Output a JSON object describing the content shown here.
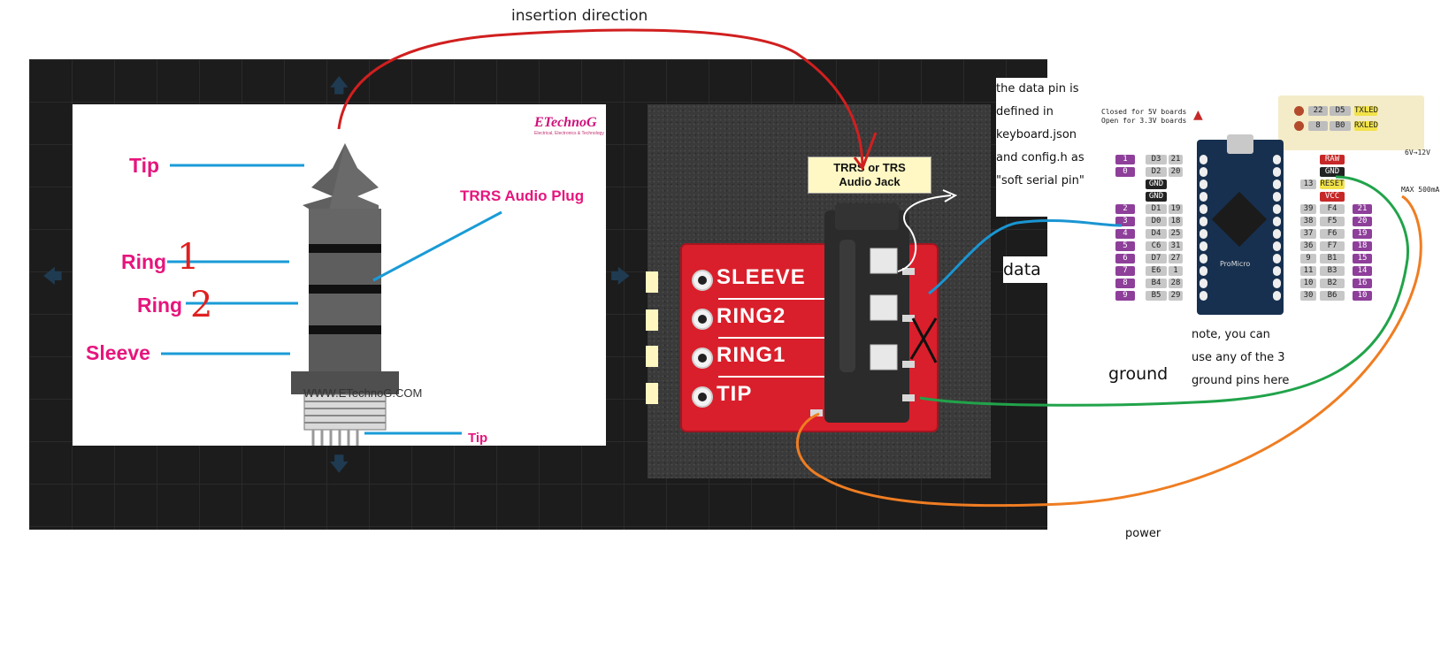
{
  "header": {
    "title": "insertion direction"
  },
  "plug": {
    "brand": "ETechnoG",
    "brand_sub": "Electrical, Electronics & Technology",
    "labels": {
      "tip": "Tip",
      "ring1": "Ring",
      "ring1_num": "1",
      "ring2": "Ring",
      "ring2_num": "2",
      "sleeve": "Sleeve",
      "plug_name": "TRRS Audio Plug",
      "tip_bottom": "Tip"
    },
    "website": "WWW.ETechnoG.COM"
  },
  "jack": {
    "tag_line1": "TRRS or TRS",
    "tag_line2": "Audio Jack",
    "pins": [
      "SLEEVE",
      "RING2",
      "RING1",
      "TIP"
    ]
  },
  "note": {
    "lines": [
      "the data pin is",
      "defined in",
      "keyboard.json",
      "and config.h as",
      "\"soft serial pin\""
    ]
  },
  "wires": {
    "data": "data",
    "ground": "ground",
    "power": "power"
  },
  "ground_note": {
    "lines": [
      "note, you can",
      "use any of the 3",
      "ground pins here"
    ]
  },
  "board": {
    "name": "ProMicro",
    "jumper_note_1": "Closed for 5V boards",
    "jumper_note_2": "Open for 3.3V boards",
    "leds": [
      {
        "num": "22",
        "pin": "D5",
        "tag": "TXLED"
      },
      {
        "num": "8",
        "pin": "B0",
        "tag": "RXLED"
      }
    ],
    "left_pins": [
      {
        "a": "1",
        "b": "D3",
        "c": "21"
      },
      {
        "a": "0",
        "b": "D2",
        "c": "20"
      },
      {
        "a": "",
        "b": "GND",
        "c": ""
      },
      {
        "a": "",
        "b": "GND",
        "c": ""
      },
      {
        "a": "2",
        "b": "D1",
        "c": "19"
      },
      {
        "a": "3",
        "b": "D0",
        "c": "18"
      },
      {
        "a": "4",
        "b": "D4",
        "c": "25"
      },
      {
        "a": "5",
        "b": "C6",
        "c": "31"
      },
      {
        "a": "6",
        "b": "D7",
        "c": "27"
      },
      {
        "a": "7",
        "b": "E6",
        "c": "1"
      },
      {
        "a": "8",
        "b": "B4",
        "c": "28"
      },
      {
        "a": "9",
        "b": "B5",
        "c": "29"
      }
    ],
    "right_pins": [
      {
        "a": "RAW",
        "b": "",
        "c": ""
      },
      {
        "a": "GND",
        "b": "",
        "c": ""
      },
      {
        "a": "RESET",
        "b": "13",
        "c": ""
      },
      {
        "a": "VCC",
        "b": "",
        "c": ""
      },
      {
        "a": "F4",
        "b": "39",
        "c": "21"
      },
      {
        "a": "F5",
        "b": "38",
        "c": "20"
      },
      {
        "a": "F6",
        "b": "37",
        "c": "19"
      },
      {
        "a": "F7",
        "b": "36",
        "c": "18"
      },
      {
        "a": "B1",
        "b": "9",
        "c": "15"
      },
      {
        "a": "B3",
        "b": "11",
        "c": "14"
      },
      {
        "a": "B2",
        "b": "10",
        "c": "16"
      },
      {
        "a": "B6",
        "b": "30",
        "c": "10"
      }
    ],
    "raw_note": "6V→12V",
    "vcc_note": "MAX 500mA"
  }
}
